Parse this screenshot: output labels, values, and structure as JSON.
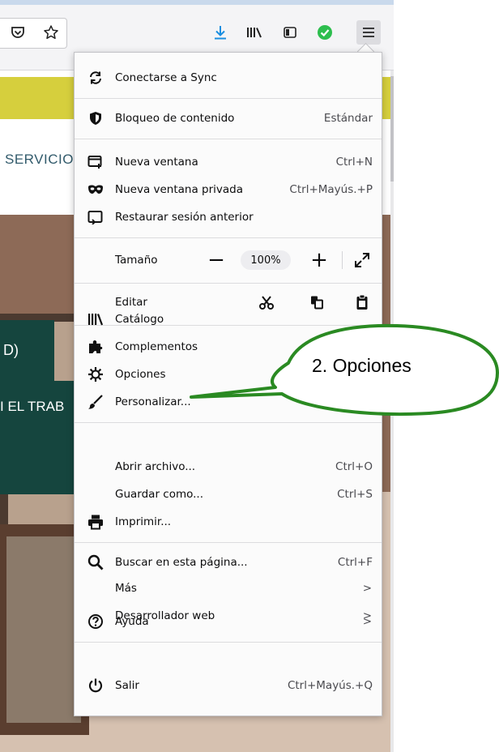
{
  "toolbar": {
    "buttons": [
      "pocket-icon",
      "bookmark-star-icon",
      "downloads-icon",
      "library-icon",
      "sidebar-icon",
      "extension-check-icon",
      "hamburger-menu-icon"
    ],
    "accent_download": "#1a8ee0",
    "accent_check": "#2dbe4e"
  },
  "page": {
    "nav_text": "SERVICIO",
    "teal_box1_text": "D)",
    "teal_box2_text": "I EL TRAB",
    "banner_color": "#d6cf3d",
    "teal_color": "#15453e"
  },
  "menu": {
    "sync": {
      "label": "Conectarse a Sync",
      "icon": "sync-icon"
    },
    "content_blocking": {
      "label": "Bloqueo de contenido",
      "value": "Estándar",
      "icon": "shield-icon"
    },
    "new_window": {
      "label": "Nueva ventana",
      "shortcut": "Ctrl+N",
      "icon": "new-window-icon"
    },
    "new_private_window": {
      "label": "Nueva ventana privada",
      "shortcut": "Ctrl+Mayús.+P",
      "icon": "private-mask-icon"
    },
    "restore_session": {
      "label": "Restaurar sesión anterior",
      "icon": "restore-session-icon"
    },
    "zoom": {
      "label": "Tamaño",
      "value": "100%",
      "minus": "−",
      "plus": "+"
    },
    "edit": {
      "label": "Editar"
    },
    "library": {
      "label": "Catálogo",
      "icon": "library-icon"
    },
    "addons": {
      "label": "Complementos",
      "icon": "puzzle-icon"
    },
    "options": {
      "label": "Opciones",
      "icon": "gear-icon"
    },
    "customize": {
      "label": "Personalizar...",
      "icon": "brush-icon"
    },
    "open_file": {
      "label": "Abrir archivo...",
      "shortcut": "Ctrl+O"
    },
    "save_as": {
      "label": "Guardar como...",
      "shortcut": "Ctrl+S"
    },
    "print": {
      "label": "Imprimir...",
      "icon": "printer-icon"
    },
    "find": {
      "label": "Buscar en esta página...",
      "shortcut": "Ctrl+F",
      "icon": "search-icon"
    },
    "more": {
      "label": "Más",
      "chevron": ">"
    },
    "web_developer": {
      "label": "Desarrollador web",
      "chevron": ">"
    },
    "help": {
      "label": "Ayuda",
      "chevron": ">",
      "icon": "help-icon"
    },
    "quit": {
      "label": "Salir",
      "shortcut": "Ctrl+Mayús.+Q",
      "icon": "power-icon"
    }
  },
  "callout": {
    "text": "2. Opciones",
    "color": "#2a8a22"
  }
}
